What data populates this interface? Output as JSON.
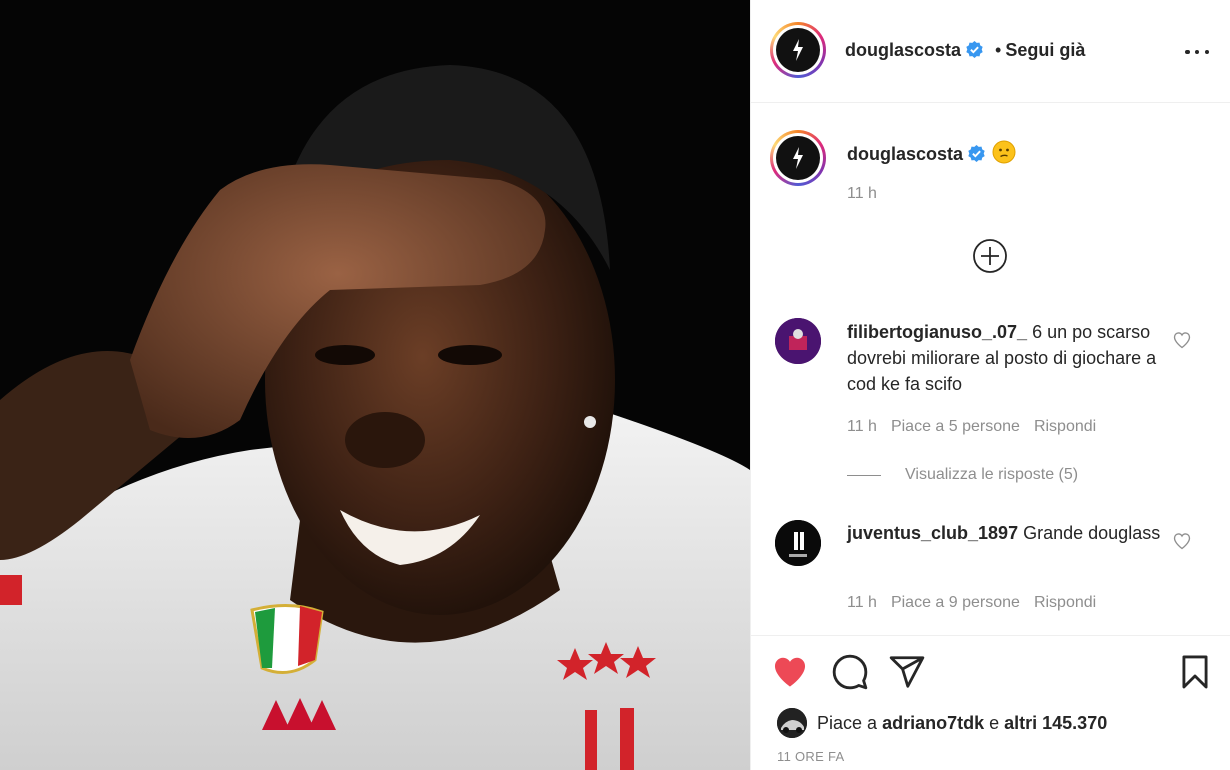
{
  "post": {
    "username": "douglascosta",
    "follow_status": "Segui già",
    "follow_separator": "•",
    "caption_time": "11 h"
  },
  "comments": [
    {
      "username": "filibertogianuso_.07_",
      "text": "6 un po scarso dovrebi miliorare al posto di giochare a cod ke fa scifo",
      "time": "11 h",
      "likes": "Piace a 5 persone",
      "reply": "Rispondi",
      "view_replies": "Visualizza le risposte (5)"
    },
    {
      "username": "juventus_club_1897",
      "text": "Grande douglass",
      "time": "11 h",
      "likes": "Piace a 9 persone",
      "reply": "Rispondi"
    }
  ],
  "likes_bar": {
    "prefix": "Piace a",
    "user": "adriano7tdk",
    "connector": "e",
    "others": "altri 145.370"
  },
  "posted_ago": "11 ORE FA",
  "icons": {
    "verified": "verified-badge-icon",
    "more": "more-options-icon",
    "add": "plus-circle-icon",
    "like": "heart-icon",
    "comment": "comment-bubble-icon",
    "share": "paper-plane-icon",
    "save": "bookmark-icon"
  },
  "colors": {
    "accent_blue": "#3897f0",
    "like_red": "#ed4956",
    "muted": "#8e8e8e"
  }
}
